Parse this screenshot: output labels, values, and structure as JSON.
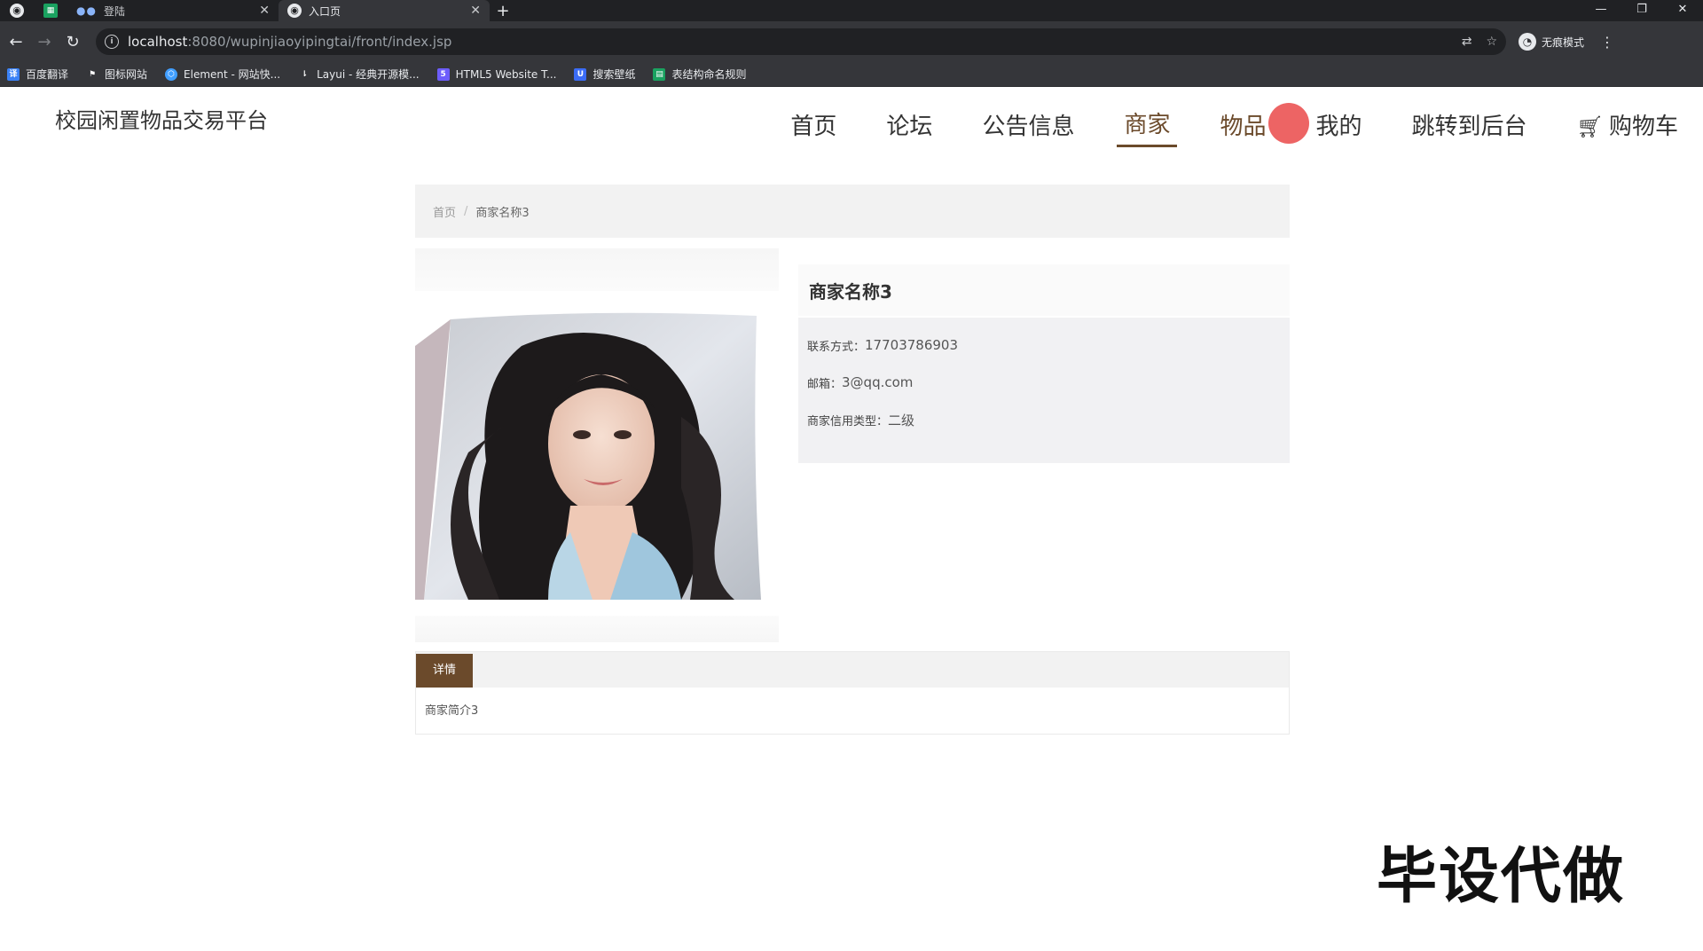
{
  "browser": {
    "tabs": [
      {
        "title": "登陆",
        "active": false
      },
      {
        "title": "入口页",
        "active": true
      }
    ],
    "url_host": "localhost",
    "url_path": ":8080/wupinjiaoyipingtai/front/index.jsp",
    "profile_label": "无痕模式",
    "bookmarks": [
      {
        "label": "百度翻译",
        "icon": "translate-icon",
        "color": "#3b82f6"
      },
      {
        "label": "图标网站",
        "icon": "flag-icon",
        "color": "#202124"
      },
      {
        "label": "Element - 网站快...",
        "icon": "element-icon",
        "color": "#409eff"
      },
      {
        "label": "Layui - 经典开源模...",
        "icon": "layui-icon",
        "color": "#5a5a5a"
      },
      {
        "label": "HTML5 Website T...",
        "icon": "html5-icon",
        "color": "#6d5dfc"
      },
      {
        "label": "搜索壁纸",
        "icon": "wallpaper-icon",
        "color": "#3b6cf6"
      },
      {
        "label": "表结构命名规则",
        "icon": "sheet-icon",
        "color": "#1aa260"
      }
    ]
  },
  "site": {
    "title": "校园闲置物品交易平台",
    "nav": [
      {
        "label": "首页"
      },
      {
        "label": "论坛"
      },
      {
        "label": "公告信息"
      },
      {
        "label": "商家",
        "active": true
      },
      {
        "label": "物品"
      },
      {
        "label": "我的"
      },
      {
        "label": "跳转到后台"
      },
      {
        "label": "购物车"
      }
    ],
    "accent_color": "#6b4a2b"
  },
  "breadcrumb": {
    "home": "首页",
    "separator": "/",
    "current": "商家名称3"
  },
  "merchant": {
    "name": "商家名称3",
    "contact_label": "联系方式：",
    "contact_value": "17703786903",
    "email_label": "邮箱：",
    "email_value": "3@qq.com",
    "credit_label": "商家信用类型：",
    "credit_value": "二级"
  },
  "detail": {
    "tab_label": "详情",
    "content": "商家简介3"
  },
  "watermark": "毕设代做"
}
